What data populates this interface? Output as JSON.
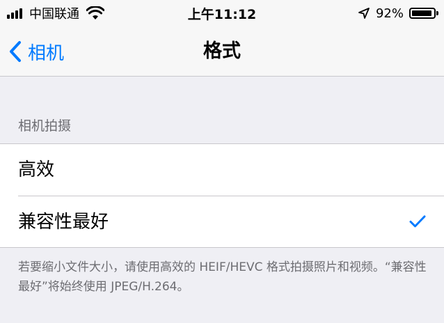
{
  "status_bar": {
    "carrier": "中国联通",
    "time": "上午11:12",
    "battery": "92%",
    "battery_level": 0.92
  },
  "nav": {
    "back_label": "相机",
    "title": "格式"
  },
  "section": {
    "header": "相机拍摄",
    "options": [
      {
        "label": "高效",
        "selected": false
      },
      {
        "label": "兼容性最好",
        "selected": true
      }
    ],
    "footer": "若要缩小文件大小，请使用高效的 HEIF/HEVC 格式拍摄照片和视频。“兼容性最好”将始终使用 JPEG/H.264。"
  },
  "colors": {
    "accent": "#007aff",
    "background": "#efeff4",
    "secondary_text": "#6d6d72"
  },
  "icons": [
    "signal-icon",
    "wifi-icon",
    "location-icon",
    "battery-icon",
    "back-chevron-icon",
    "checkmark-icon"
  ]
}
